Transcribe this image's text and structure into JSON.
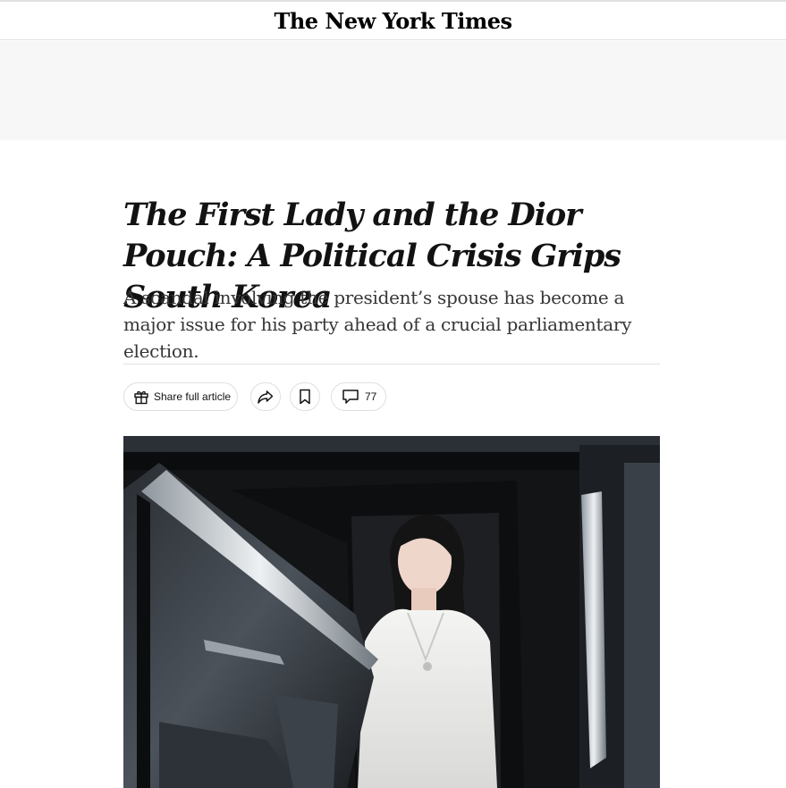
{
  "masthead": {
    "logo_text": "The New York Times"
  },
  "article": {
    "headline": "The First Lady and the Dior Pouch: A Political Crisis Grips South Korea",
    "summary": "A scandal involving the president’s spouse has become a major issue for his party ahead of a crucial parliamentary election."
  },
  "toolbar": {
    "share_full_label": "Share full article",
    "comments_count": "77"
  },
  "icons": {
    "gift": "gift-icon",
    "share": "share-arrow-icon",
    "save": "bookmark-icon",
    "comments": "comment-bubble-icon"
  },
  "colors": {
    "text": "#121212",
    "summary": "#363636",
    "rule": "#e2e2e2",
    "ad_bg": "#f7f7f7"
  }
}
